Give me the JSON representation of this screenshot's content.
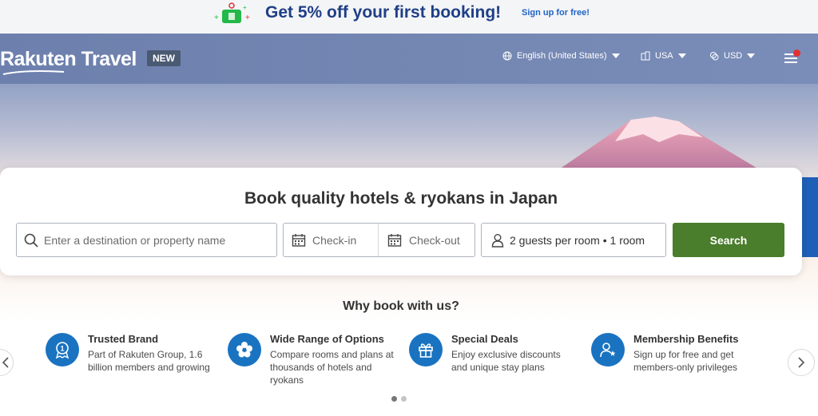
{
  "promo": {
    "headline": "Get 5% off your first booking!",
    "signup_link": "Sign up for free!"
  },
  "header": {
    "logo": "Rakuten Travel",
    "badge": "NEW",
    "language": "English (United States)",
    "country": "USA",
    "currency": "USD"
  },
  "search": {
    "heading": "Book quality hotels & ryokans in Japan",
    "destination_placeholder": "Enter a destination or property name",
    "checkin_placeholder": "Check-in",
    "checkout_placeholder": "Check-out",
    "guests_value": "2 guests per room • 1 room",
    "search_button": "Search"
  },
  "why": {
    "heading": "Why book with us?",
    "benefits": [
      {
        "title": "Trusted Brand",
        "desc": "Part of Rakuten Group, 1.6 billion members and growing",
        "icon": "badge-icon"
      },
      {
        "title": "Wide Range of Options",
        "desc": "Compare rooms and plans at thousands of hotels and ryokans",
        "icon": "flower-icon"
      },
      {
        "title": "Special Deals",
        "desc": "Enjoy exclusive discounts and unique stay plans",
        "icon": "gift-icon"
      },
      {
        "title": "Membership Benefits",
        "desc": "Sign up for free and get members-only privileges",
        "icon": "member-icon"
      }
    ]
  },
  "carousel": {
    "pages": 2,
    "active": 1
  },
  "colors": {
    "promo_text": "#1f3f86",
    "accent_blue": "#1a73c1",
    "search_green": "#4a7d2c",
    "notification_dot": "#e23131"
  }
}
